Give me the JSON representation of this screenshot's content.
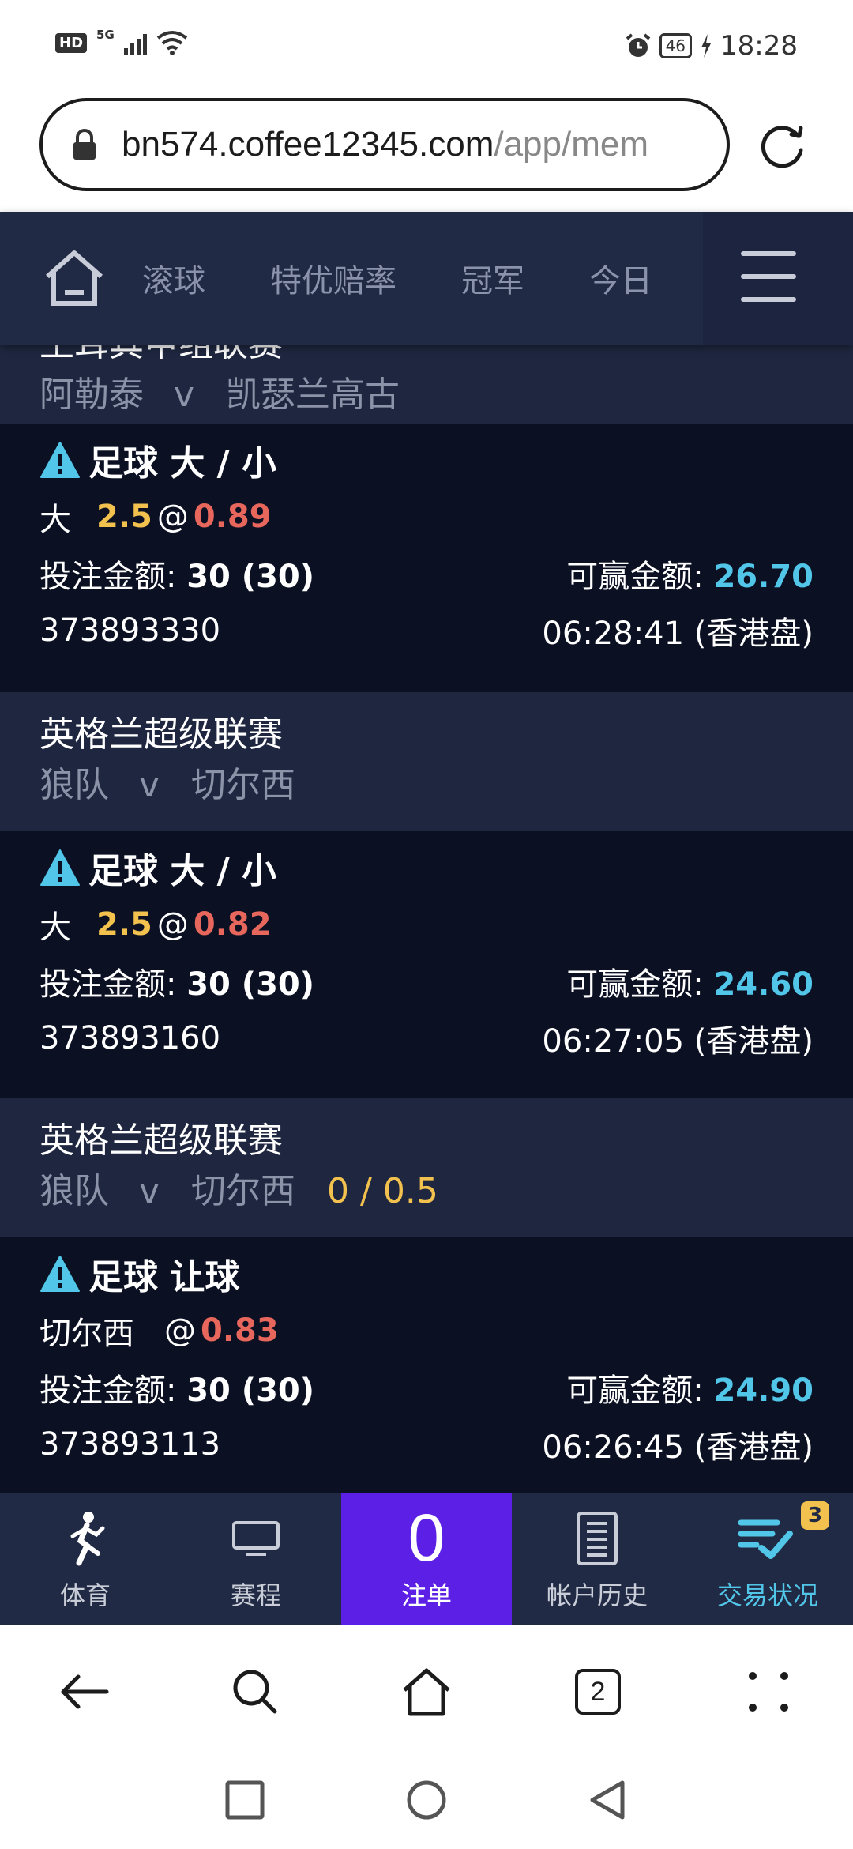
{
  "status_bar": {
    "hd": "HD",
    "network": "5G",
    "battery": "46",
    "time": "18:28"
  },
  "browser": {
    "url_host": "bn574.coffee12345.com",
    "url_path": "/app/mem",
    "tabs_count": "2"
  },
  "top_nav": {
    "tabs": [
      {
        "label": "滚球"
      },
      {
        "label": "特优赔率"
      },
      {
        "label": "冠军"
      },
      {
        "label": "今日"
      }
    ]
  },
  "bets": [
    {
      "league": "土耳其甲组联赛",
      "home": "阿勒泰",
      "vs": "v",
      "away": "凯瑟兰高古",
      "handicap": "",
      "sport_market": "足球 大 / 小",
      "selection": "大",
      "points": "2.5",
      "at": "@",
      "odds": "0.89",
      "stake_label": "投注金额:",
      "stake": "30 (30)",
      "win_label": "可赢金额:",
      "win": "26.70",
      "ticket_id": "373893330",
      "time": "06:28:41 (香港盘)"
    },
    {
      "league": "英格兰超级联赛",
      "home": "狼队",
      "vs": "v",
      "away": "切尔西",
      "handicap": "",
      "sport_market": "足球 大 / 小",
      "selection": "大",
      "points": "2.5",
      "at": "@",
      "odds": "0.82",
      "stake_label": "投注金额:",
      "stake": "30 (30)",
      "win_label": "可赢金额:",
      "win": "24.60",
      "ticket_id": "373893160",
      "time": "06:27:05 (香港盘)"
    },
    {
      "league": "英格兰超级联赛",
      "home": "狼队",
      "vs": "v",
      "away": "切尔西",
      "handicap": "0 / 0.5",
      "sport_market": "足球 让球",
      "selection": "切尔西",
      "points": "",
      "at": "@",
      "odds": "0.83",
      "stake_label": "投注金额:",
      "stake": "30 (30)",
      "win_label": "可赢金额:",
      "win": "24.90",
      "ticket_id": "373893113",
      "time": "06:26:45 (香港盘)"
    }
  ],
  "bottom_tabs": {
    "sports": "体育",
    "schedule": "赛程",
    "betslip_count": "0",
    "betslip": "注单",
    "history": "帐户历史",
    "status": "交易状况",
    "status_badge": "3"
  },
  "colors": {
    "nav_bg": "#212a44",
    "content_bg": "#0b1023",
    "match_bg": "#1f2740",
    "accent_cyan": "#52c6e8",
    "accent_yellow": "#f2c14e",
    "odds_red": "#e8675c",
    "betslip_purple": "#5b1fe6"
  }
}
